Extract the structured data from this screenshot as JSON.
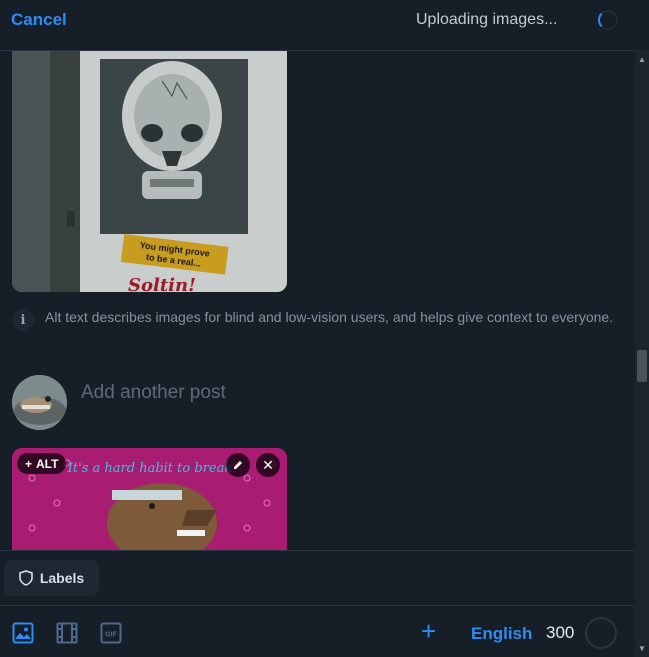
{
  "header": {
    "cancel_label": "Cancel",
    "status_text": "Uploading images..."
  },
  "post1": {
    "image_caption_lines": [
      "You might prove",
      "to be a real...",
      "Soltin!"
    ],
    "alt_info_text": "Alt text describes images for blind and low-vision users, and helps give context to everyone."
  },
  "reply": {
    "placeholder": "Add another post"
  },
  "post2": {
    "alt_badge_label": "ALT",
    "image_caption": "It's a hard habit to break"
  },
  "labels": {
    "button_label": "Labels"
  },
  "toolbar": {
    "language": "English",
    "char_remaining": "300"
  },
  "colors": {
    "accent": "#2f8cf4",
    "background": "#161e27"
  },
  "icons": [
    "spinner-icon",
    "info-icon",
    "plus-icon",
    "pencil-icon",
    "close-icon",
    "shield-icon",
    "image-icon",
    "video-icon",
    "gif-icon",
    "add-icon"
  ]
}
